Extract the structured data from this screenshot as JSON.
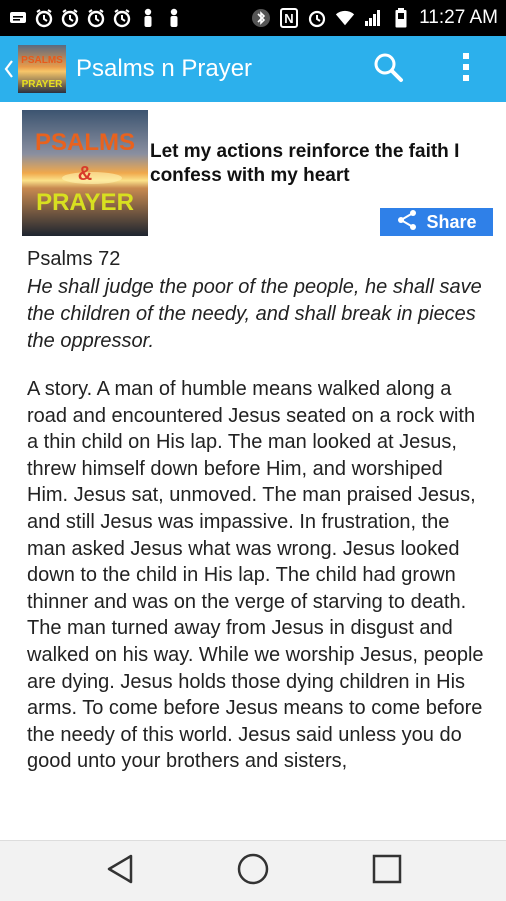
{
  "status_bar": {
    "time": "11:27 AM",
    "icons": [
      "message-icon",
      "alarm-icon",
      "alarm-icon",
      "alarm-icon",
      "alarm-icon",
      "person-icon",
      "person-icon",
      "bluetooth-icon",
      "nfc-icon",
      "alarm-clock-icon",
      "wifi-icon",
      "signal-icon",
      "battery-icon"
    ]
  },
  "app_bar": {
    "title": "Psalms n Prayer",
    "logo_text_top": "PSALMS",
    "logo_text_bottom": "PRAYER",
    "accent": "#2cb0ec"
  },
  "header": {
    "image_top": "PSALMS",
    "image_mid": "&",
    "image_bottom": "PRAYER",
    "quote": "Let my actions reinforce the faith I confess with my heart",
    "share_label": "Share",
    "share_color": "#2f80e8"
  },
  "scripture": {
    "reference": "Psalms 72",
    "verse": "He shall judge the poor of the people, he shall save the children of the needy, and shall break in pieces the oppressor."
  },
  "story": {
    "text": "A story. A man of humble means walked along a road and encountered Jesus seated on a rock with a thin child on His lap. The man looked at Jesus, threw himself down before Him, and worshiped Him. Jesus sat, unmoved. The man praised Jesus, and still Jesus was impassive. In frustration, the man asked Jesus what was wrong. Jesus looked down to the child in His lap. The child had grown thinner and was on the verge of starving to death. The man turned away from Jesus in disgust and walked on his way. While we worship Jesus, people are dying. Jesus holds those dying children in His arms. To come before Jesus means to come before the needy of this world. Jesus said unless you do good unto your brothers and sisters,"
  },
  "nav_bar": {
    "buttons": [
      "back-icon",
      "home-icon",
      "recents-icon"
    ]
  }
}
